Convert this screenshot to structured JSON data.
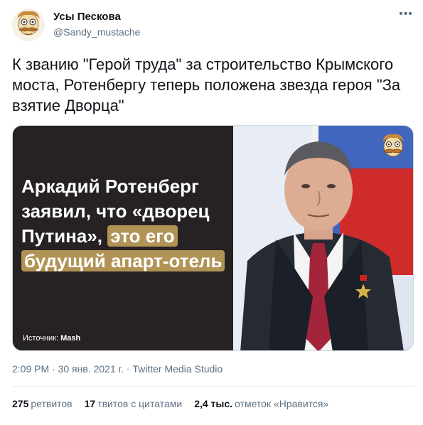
{
  "user": {
    "name": "Усы Пескова",
    "handle": "@Sandy_mustache",
    "avatar_icon": "mustache-cartoon-avatar"
  },
  "more_icon": "more-dots-icon",
  "tweet": {
    "text": "К званию \"Герой труда\" за строительство Крымского\nмоста, Ротенбергу теперь положена звезда героя \"За\nвзятие Дворца\""
  },
  "media": {
    "headline_part1": "Аркадий Ротенберг заявил, что «дворец Путина», ",
    "headline_highlight1": "это его",
    "headline_highlight2": "будущий апарт-отель",
    "source_label": "Источник: ",
    "source_name": "Mash",
    "highlight_color": "#b19356"
  },
  "meta": {
    "time": "2:09 PM",
    "sep1": " · ",
    "date": "30 янв. 2021 г.",
    "sep2": " · ",
    "client": "Twitter Media Studio"
  },
  "stats": {
    "retweets_count": "275",
    "retweets_label": "ретвитов",
    "quotes_count": "17",
    "quotes_label": "твитов с цитатами",
    "likes_count": "2,4 тыс.",
    "likes_label": "отметок «Нравится»"
  }
}
